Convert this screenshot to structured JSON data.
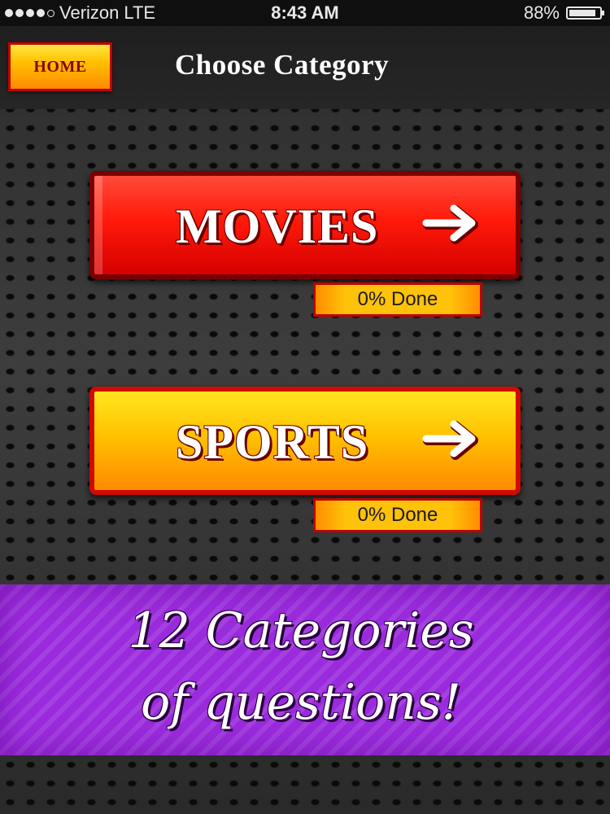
{
  "status_bar": {
    "carrier": "Verizon",
    "network": "LTE",
    "time": "8:43 AM",
    "battery": "88%"
  },
  "header": {
    "home_label": "HOME",
    "title": "Choose Category"
  },
  "categories": [
    {
      "label": "MOVIES",
      "progress_text": "0% Done",
      "progress": 0
    },
    {
      "label": "SPORTS",
      "progress_text": "0% Done",
      "progress": 0
    }
  ],
  "promo": {
    "line1": "12 Categories",
    "line2": "of questions!"
  },
  "colors": {
    "movies_button": "#ff1a0a",
    "sports_button": "#ffc200",
    "banner": "#9a2bdc",
    "home_button": "#ffc000"
  },
  "icons": [
    "signal-icon",
    "battery-icon",
    "arrow-right-icon"
  ]
}
